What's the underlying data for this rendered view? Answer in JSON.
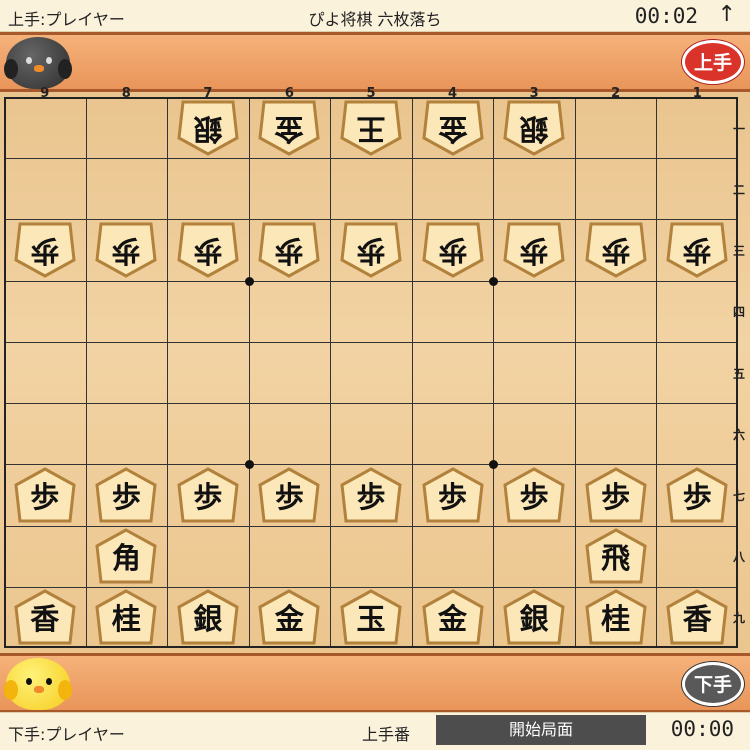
{
  "header": {
    "gote_player": "上手:プレイヤー",
    "title": "ぴよ将棋 六枚落ち",
    "gote_timer": "00:02",
    "arrow_glyph": "↑"
  },
  "gote_hand": {
    "badge": "上手"
  },
  "sente_hand": {
    "badge": "下手"
  },
  "board": {
    "files": [
      "9",
      "8",
      "7",
      "6",
      "5",
      "4",
      "3",
      "2",
      "1"
    ],
    "ranks": [
      "一",
      "二",
      "三",
      "四",
      "五",
      "六",
      "七",
      "八",
      "九"
    ],
    "pieces": [
      {
        "file": 7,
        "rank": 1,
        "char": "銀",
        "side": "gote"
      },
      {
        "file": 6,
        "rank": 1,
        "char": "金",
        "side": "gote"
      },
      {
        "file": 5,
        "rank": 1,
        "char": "王",
        "side": "gote"
      },
      {
        "file": 4,
        "rank": 1,
        "char": "金",
        "side": "gote"
      },
      {
        "file": 3,
        "rank": 1,
        "char": "銀",
        "side": "gote"
      },
      {
        "file": 9,
        "rank": 3,
        "char": "歩",
        "side": "gote"
      },
      {
        "file": 8,
        "rank": 3,
        "char": "歩",
        "side": "gote"
      },
      {
        "file": 7,
        "rank": 3,
        "char": "歩",
        "side": "gote"
      },
      {
        "file": 6,
        "rank": 3,
        "char": "歩",
        "side": "gote"
      },
      {
        "file": 5,
        "rank": 3,
        "char": "歩",
        "side": "gote"
      },
      {
        "file": 4,
        "rank": 3,
        "char": "歩",
        "side": "gote"
      },
      {
        "file": 3,
        "rank": 3,
        "char": "歩",
        "side": "gote"
      },
      {
        "file": 2,
        "rank": 3,
        "char": "歩",
        "side": "gote"
      },
      {
        "file": 1,
        "rank": 3,
        "char": "歩",
        "side": "gote"
      },
      {
        "file": 9,
        "rank": 7,
        "char": "歩",
        "side": "sente"
      },
      {
        "file": 8,
        "rank": 7,
        "char": "歩",
        "side": "sente"
      },
      {
        "file": 7,
        "rank": 7,
        "char": "歩",
        "side": "sente"
      },
      {
        "file": 6,
        "rank": 7,
        "char": "歩",
        "side": "sente"
      },
      {
        "file": 5,
        "rank": 7,
        "char": "歩",
        "side": "sente"
      },
      {
        "file": 4,
        "rank": 7,
        "char": "歩",
        "side": "sente"
      },
      {
        "file": 3,
        "rank": 7,
        "char": "歩",
        "side": "sente"
      },
      {
        "file": 2,
        "rank": 7,
        "char": "歩",
        "side": "sente"
      },
      {
        "file": 1,
        "rank": 7,
        "char": "歩",
        "side": "sente"
      },
      {
        "file": 8,
        "rank": 8,
        "char": "角",
        "side": "sente"
      },
      {
        "file": 2,
        "rank": 8,
        "char": "飛",
        "side": "sente"
      },
      {
        "file": 9,
        "rank": 9,
        "char": "香",
        "side": "sente"
      },
      {
        "file": 8,
        "rank": 9,
        "char": "桂",
        "side": "sente"
      },
      {
        "file": 7,
        "rank": 9,
        "char": "銀",
        "side": "sente"
      },
      {
        "file": 6,
        "rank": 9,
        "char": "金",
        "side": "sente"
      },
      {
        "file": 5,
        "rank": 9,
        "char": "玉",
        "side": "sente"
      },
      {
        "file": 4,
        "rank": 9,
        "char": "金",
        "side": "sente"
      },
      {
        "file": 3,
        "rank": 9,
        "char": "銀",
        "side": "sente"
      },
      {
        "file": 2,
        "rank": 9,
        "char": "桂",
        "side": "sente"
      },
      {
        "file": 1,
        "rank": 9,
        "char": "香",
        "side": "sente"
      }
    ]
  },
  "footer": {
    "sente_player": "下手:プレイヤー",
    "turn": "上手番",
    "position_button": "開始局面",
    "sente_timer": "00:00"
  },
  "colors": {
    "gote_badge": "#d9332a",
    "sente_badge": "#595959",
    "position_button_bg": "#4d4d4d"
  },
  "icons": {
    "gote_avatar": "black-chick-icon",
    "sente_avatar": "yellow-chick-icon",
    "arrow": "up-arrow-icon"
  }
}
